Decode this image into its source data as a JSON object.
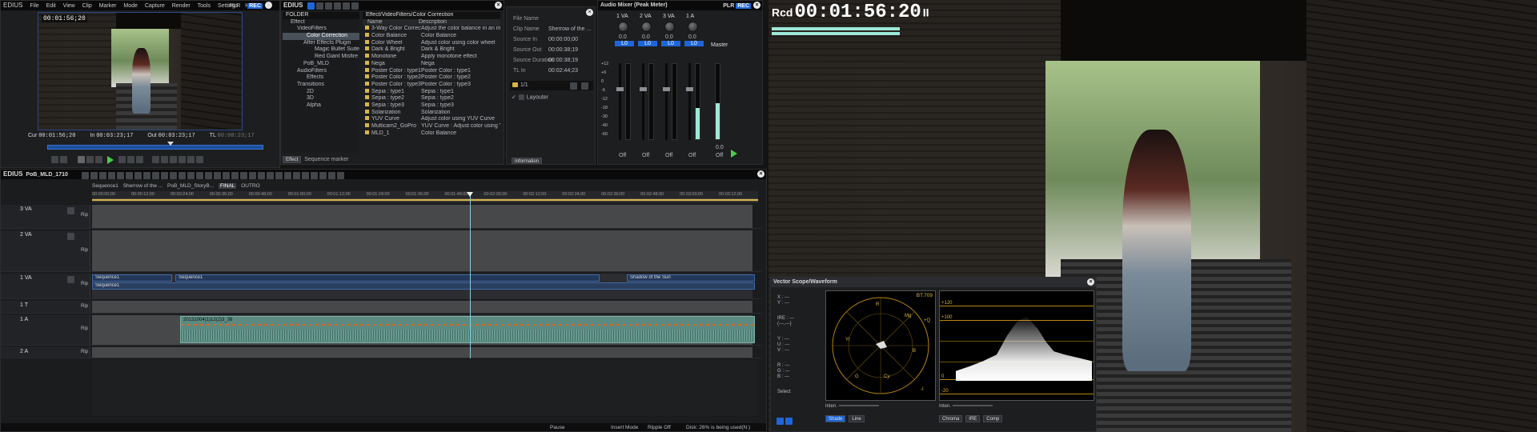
{
  "player": {
    "brand": "EDIUS",
    "menu": [
      "File",
      "Edit",
      "View",
      "Clip",
      "Marker",
      "Mode",
      "Capture",
      "Render",
      "Tools",
      "Settings",
      "Help"
    ],
    "plr": "PLR",
    "rec": "REC",
    "overlay_tc": "00:01:56;20",
    "cur_label": "Cur",
    "cur_tc": "00:01:56;20",
    "in_label": "In",
    "in_tc": "00:03:23;17",
    "out_label": "Out",
    "out_tc": "00:03:23;17",
    "tl_label": "TL",
    "tl_tc": "00:00:23;17"
  },
  "effects": {
    "brand": "EDIUS",
    "folder_header": "FOLDER",
    "path": "Effect/VideoFilters/Color Correction",
    "tree": [
      "Effect",
      "VideoFilters",
      "Color Correction",
      "After Effects Plugin",
      "Magic Bullet Suite",
      "Red Giant Misfire",
      "PoB_MLD",
      "AudioFilters",
      "Effects",
      "Transitions",
      "2D",
      "3D",
      "Alpha"
    ],
    "col_name": "Name",
    "col_desc": "Description",
    "items": [
      {
        "name": "3-Way Color Correction",
        "desc": "Adjust the color balance in an image"
      },
      {
        "name": "Color Balance",
        "desc": "Color Balance"
      },
      {
        "name": "Color Wheel",
        "desc": "Adjust color using color wheel"
      },
      {
        "name": "Dark & Bright",
        "desc": "Dark & Bright"
      },
      {
        "name": "Monotone",
        "desc": "Apply monotone effect"
      },
      {
        "name": "Nega",
        "desc": "Nega"
      },
      {
        "name": "Poster Color : type1",
        "desc": "Poster Color : type1"
      },
      {
        "name": "Poster Color : type2",
        "desc": "Poster Color : type2"
      },
      {
        "name": "Poster Color : type3",
        "desc": "Poster Color : type3"
      },
      {
        "name": "Sepia : type1",
        "desc": "Sepia : type1"
      },
      {
        "name": "Sepia : type2",
        "desc": "Sepia : type2"
      },
      {
        "name": "Sepia : type3",
        "desc": "Sepia : type3"
      },
      {
        "name": "Solarization",
        "desc": "Solarization"
      },
      {
        "name": "YUV Curve",
        "desc": "Adjust color using YUV Curve"
      },
      {
        "name": "Multicam2_GoPro",
        "desc": "YUV Curve : Adjust color using YUV Curve"
      },
      {
        "name": "MLD_1",
        "desc": "Color Balance"
      }
    ],
    "tab_effect": "Effect",
    "tab_marker": "Sequence marker"
  },
  "info": {
    "fields": [
      {
        "label": "File Name",
        "value": ""
      },
      {
        "label": "Clip Name",
        "value": "Sherrow of the ..."
      },
      {
        "label": "Source In",
        "value": "00:00:00;00"
      },
      {
        "label": "Source Out",
        "value": "00:00:38;19"
      },
      {
        "label": "Source Duration",
        "value": "00:00:38;19"
      },
      {
        "label": "TL In",
        "value": "00:02:44;23"
      }
    ],
    "count": "1/1",
    "layouter": "Layouter",
    "tab": "Information"
  },
  "mixer": {
    "title": "Audio Mixer (Peak Meter)",
    "plr": "PLR",
    "rec": "REC",
    "channels": [
      {
        "name": "1 VA",
        "gain": "0.0",
        "pan": "L0",
        "off": "Off",
        "level": 0
      },
      {
        "name": "2 VA",
        "gain": "0.0",
        "pan": "L0",
        "off": "Off",
        "level": 0
      },
      {
        "name": "3 VA",
        "gain": "0.0",
        "pan": "L0",
        "off": "Off",
        "level": 0
      },
      {
        "name": "1 A",
        "gain": "0.0",
        "pan": "L0",
        "off": "Off",
        "level": 0.42
      }
    ],
    "master": "Master",
    "master_gain": "0.0",
    "master_off": "Off",
    "master_level": 0.48,
    "scale": [
      "+12",
      "+6",
      "0",
      "-6",
      "-12",
      "-18",
      "-30",
      "-40",
      "-60"
    ]
  },
  "bigplayer": {
    "rcd": "Rcd",
    "tc": "00:01:56:20",
    "pause": "II"
  },
  "timeline": {
    "brand": "EDIUS",
    "project": "PoB_MLD_1710",
    "tabs": [
      "Sequence1",
      "Sherrow of the ...",
      "PoB_MLD_StoryB...",
      "FINAL",
      "OUTRO"
    ],
    "ruler": [
      "00:00:00;00",
      "00:00:12;00",
      "00:00:24;00",
      "00:00:36;00",
      "00:00:48;00",
      "00:01:00;00",
      "00:01:12;00",
      "00:01:24;00",
      "00:01:36;00",
      "00:01:48;00",
      "00:02:00;00",
      "00:02:12;00",
      "00:02:24;00",
      "00:02:36;00",
      "00:02:48;00",
      "00:03:00;00",
      "00:03:12;00"
    ],
    "tracks": {
      "va3": "3 VA",
      "va2": "2 VA",
      "va1": "1 VA",
      "t1": "1 T",
      "a1": "1 A",
      "a2": "2 A"
    },
    "clip_seq1a": "Sequence1",
    "clip_seq1b": "Sequence1",
    "clip_seq1c": "Sequence1",
    "clip_shadow": "Shadow of the Sun",
    "audio_clip": "20131004(1)12(2)3_38",
    "status": {
      "pause": "Pause",
      "insert": "Insert Mode",
      "ripple": "Ripple Off",
      "disk": "Disk: 26% is being used(N:)"
    }
  },
  "scope": {
    "title": "Vector Scope/Waveform",
    "readouts": [
      "X : ---",
      "Y : ---",
      "IRE : ---",
      "(---,---)",
      "Y : ---",
      "U : ---",
      "V : ---",
      "R : ---",
      "G : ---",
      "B : ---"
    ],
    "select_label": "Select",
    "bt": "BT.709",
    "intens1": "Inten.",
    "intens2": "Inten.",
    "shade": "Shade",
    "line": "Line",
    "chroma": "Chroma",
    "ire": "IRE",
    "comp": "Comp",
    "wf_labels": [
      "+120",
      "+100",
      "0",
      "-20"
    ],
    "vs_labels": [
      "R",
      "Mg",
      "+Q",
      "B",
      "Cy",
      "G",
      "Yl",
      "-I"
    ]
  },
  "colors": {
    "accent": "#1e66d8",
    "meter": "#9ee8d6",
    "audio_clip": "#5c8a80"
  }
}
